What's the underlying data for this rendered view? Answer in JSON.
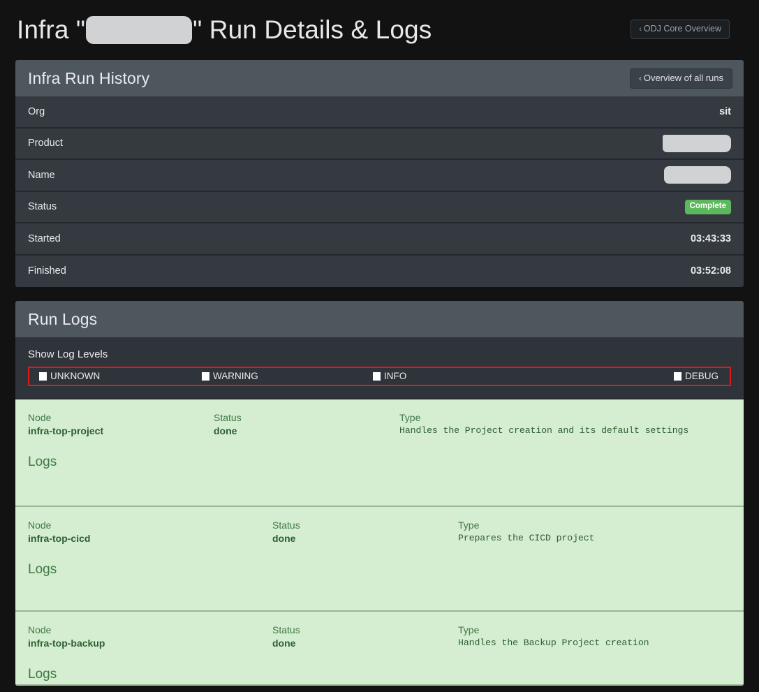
{
  "header": {
    "title_prefix": "Infra \"",
    "title_suffix": "\" Run Details & Logs",
    "redacted_name": "",
    "overview_button": "ODJ Core Overview",
    "chevron": "‹"
  },
  "run_history": {
    "panel_title": "Infra Run History",
    "all_runs_button": "Overview of all runs",
    "chevron": "‹",
    "rows": [
      {
        "key": "Org",
        "value": "sit",
        "type": "text"
      },
      {
        "key": "Product",
        "value": "",
        "type": "redacted"
      },
      {
        "key": "Name",
        "value": "",
        "type": "redacted"
      },
      {
        "key": "Status",
        "value": "Complete",
        "type": "badge"
      },
      {
        "key": "Started",
        "value": "03:43:33",
        "type": "text"
      },
      {
        "key": "Finished",
        "value": "03:52:08",
        "type": "text"
      }
    ]
  },
  "run_logs": {
    "panel_title": "Run Logs",
    "filter_label": "Show Log Levels",
    "levels": [
      {
        "label": "UNKNOWN",
        "checked": true
      },
      {
        "label": "WARNING",
        "checked": true
      },
      {
        "label": "INFO",
        "checked": true
      },
      {
        "label": "DEBUG",
        "checked": true
      }
    ],
    "column_headers": {
      "node": "Node",
      "status": "Status",
      "type": "Type"
    },
    "logs_label": "Logs",
    "cards": [
      {
        "node": "infra-top-project",
        "status": "done",
        "type": "Handles the Project creation and its default settings",
        "logs_label": "Logs"
      },
      {
        "node": "infra-top-cicd",
        "status": "done",
        "type": "Prepares the CICD project",
        "logs_label": "Logs"
      },
      {
        "node": "infra-top-backup",
        "status": "done",
        "type": "Handles the Backup Project creation",
        "logs_label": "Logs"
      }
    ]
  },
  "colors": {
    "page_background": "#121212",
    "panel_body": "#2f343a",
    "panel_header": "#4e565e",
    "row_background": "#343a40",
    "log_card_green": "#d5edd1",
    "badge_green": "#5cb85c",
    "highlight_red": "#e01b1b",
    "redaction_gray": "#d0d2d4"
  }
}
